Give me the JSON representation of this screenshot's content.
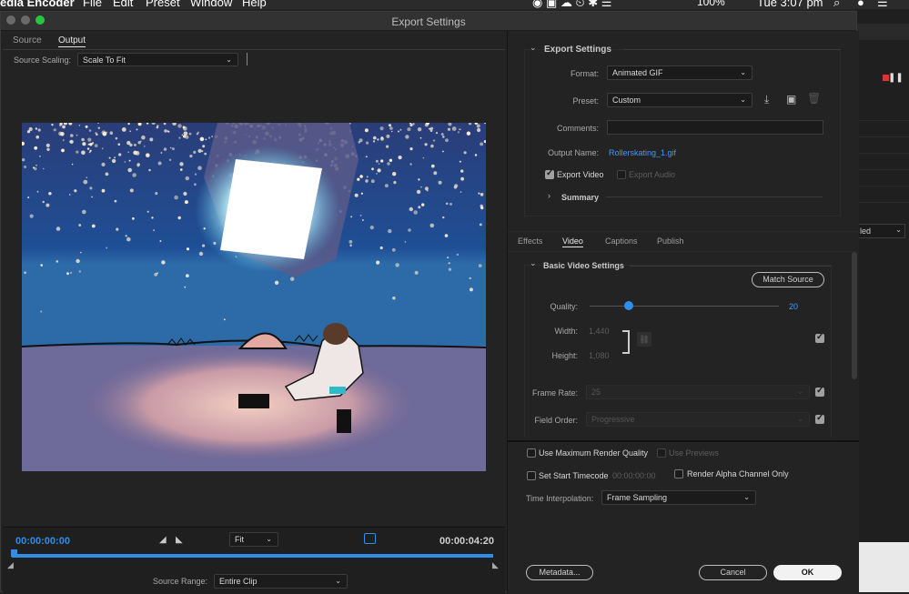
{
  "menubar": {
    "app_name": "edia Encoder",
    "items": [
      "File",
      "Edit",
      "Preset",
      "Window",
      "Help"
    ],
    "battery": "100%",
    "clock": "Tue 3:07 pm"
  },
  "dialog": {
    "title": "Export Settings"
  },
  "left": {
    "tabs": [
      "Source",
      "Output"
    ],
    "source_scaling_label": "Source Scaling:",
    "source_scaling_value": "Scale To Fit",
    "timecode_start": "00:00:00:00",
    "timecode_end": "00:00:04:20",
    "zoom_value": "Fit",
    "source_range_label": "Source Range:",
    "source_range_value": "Entire Clip"
  },
  "right": {
    "export_settings_header": "Export Settings",
    "format_label": "Format:",
    "format_value": "Animated GIF",
    "preset_label": "Preset:",
    "preset_value": "Custom",
    "comments_label": "Comments:",
    "comments_value": "",
    "output_name_label": "Output Name:",
    "output_name_value": "Rollerskating_1.gif",
    "export_video_label": "Export Video",
    "export_audio_label": "Export Audio",
    "summary_label": "Summary",
    "tabs": [
      "Effects",
      "Video",
      "Captions",
      "Publish"
    ],
    "basic_video_header": "Basic Video Settings",
    "match_source_label": "Match Source",
    "quality_label": "Quality:",
    "quality_value": "20",
    "quality_fraction": 0.2,
    "width_label": "Width:",
    "width_value": "1,440",
    "height_label": "Height:",
    "height_value": "1,080",
    "frame_rate_label": "Frame Rate:",
    "frame_rate_value": "25",
    "field_order_label": "Field Order:",
    "field_order_value": "Progressive",
    "max_render_label": "Use Maximum Render Quality",
    "use_previews_label": "Use Previews",
    "start_timecode_label": "Set Start Timecode",
    "start_timecode_value": "00:00:00:00",
    "alpha_label": "Render Alpha Channel Only",
    "time_interp_label": "Time Interpolation:",
    "time_interp_value": "Frame Sampling",
    "metadata_label": "Metadata...",
    "cancel_label": "Cancel",
    "ok_label": "OK"
  },
  "bg_app": {
    "dropdown_fragment": "led"
  },
  "colors": {
    "accent_blue": "#2f8fe8",
    "link_blue": "#3d9bff",
    "record_red": "#d33"
  }
}
